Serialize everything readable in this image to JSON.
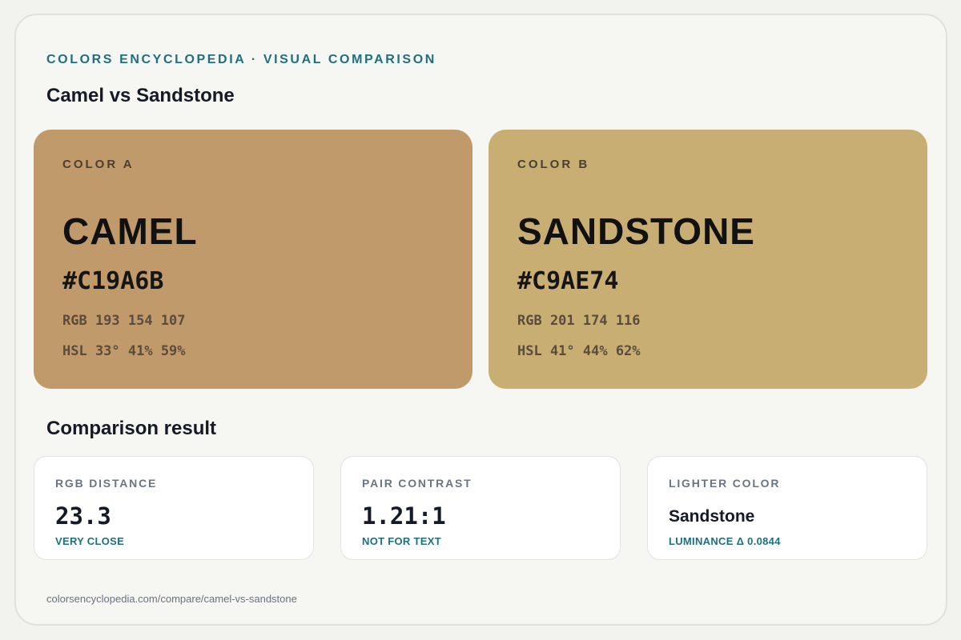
{
  "header": {
    "eyebrow": "COLORS ENCYCLOPEDIA · VISUAL COMPARISON",
    "title": "Camel vs Sandstone"
  },
  "colors": {
    "a": {
      "label": "COLOR A",
      "name": "CAMEL",
      "hex": "#C19A6B",
      "rgb": "RGB 193 154 107",
      "hsl": "HSL 33° 41% 59%",
      "swatch_color": "#C19A6B"
    },
    "b": {
      "label": "COLOR B",
      "name": "SANDSTONE",
      "hex": "#C9AE74",
      "rgb": "RGB 201 174 116",
      "hsl": "HSL 41° 44% 62%",
      "swatch_color": "#C9AE74"
    }
  },
  "result": {
    "title": "Comparison result",
    "metrics": [
      {
        "label": "RGB DISTANCE",
        "value": "23.3",
        "sub": "VERY CLOSE"
      },
      {
        "label": "PAIR CONTRAST",
        "value": "1.21:1",
        "sub": "NOT FOR TEXT"
      },
      {
        "label": "LIGHTER COLOR",
        "value": "Sandstone",
        "sub": "LUMINANCE Δ 0.0844"
      }
    ]
  },
  "footer": {
    "url": "colorsencyclopedia.com/compare/camel-vs-sandstone"
  },
  "theme": {
    "accent": "#1E6F80",
    "background": "#F6F6F2"
  }
}
